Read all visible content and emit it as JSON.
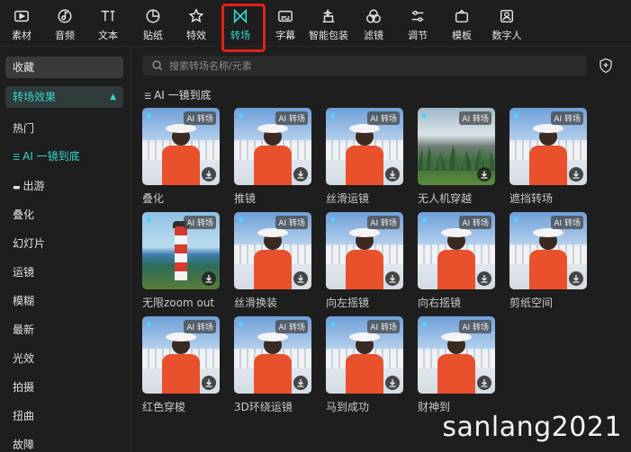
{
  "toolbar": {
    "items": [
      {
        "label": "素材",
        "icon": "media-icon"
      },
      {
        "label": "音频",
        "icon": "audio-icon"
      },
      {
        "label": "文本",
        "icon": "text-icon"
      },
      {
        "label": "贴纸",
        "icon": "sticker-icon"
      },
      {
        "label": "特效",
        "icon": "effects-icon"
      },
      {
        "label": "转场",
        "icon": "transition-icon"
      },
      {
        "label": "字幕",
        "icon": "subtitle-icon"
      },
      {
        "label": "智能包装",
        "icon": "smart-pack-icon"
      },
      {
        "label": "滤镜",
        "icon": "filter-icon"
      },
      {
        "label": "调节",
        "icon": "adjust-icon"
      },
      {
        "label": "模板",
        "icon": "template-icon"
      },
      {
        "label": "数字人",
        "icon": "digital-human-icon"
      }
    ],
    "active_index": 5,
    "accent_color": "#38d6cf",
    "highlight_color": "#e0201b"
  },
  "sidebar": {
    "favorites": "收藏",
    "category": "转场效果",
    "items": [
      {
        "label": "热门"
      },
      {
        "label": "AI 一镜到底",
        "prefix": "☰",
        "selected": true
      },
      {
        "label": "出游",
        "prefix": "▬"
      },
      {
        "label": "叠化"
      },
      {
        "label": "幻灯片"
      },
      {
        "label": "运镜"
      },
      {
        "label": "模糊"
      },
      {
        "label": "最新"
      },
      {
        "label": "光效"
      },
      {
        "label": "拍摄"
      },
      {
        "label": "扭曲"
      },
      {
        "label": "故障"
      }
    ]
  },
  "search": {
    "placeholder": "搜索转场名称/元素"
  },
  "section_title": "AI 一镜到底",
  "cards": [
    {
      "label": "叠化",
      "tag": "AI 转场",
      "style": "person"
    },
    {
      "label": "推镜",
      "tag": "AI 转场",
      "style": "person"
    },
    {
      "label": "丝滑运镜",
      "tag": "AI 转场",
      "style": "person"
    },
    {
      "label": "无人机穿越",
      "tag": "AI 转场",
      "style": "mountain"
    },
    {
      "label": "遮挡转场",
      "tag": "AI 转场",
      "style": "person"
    },
    {
      "label": "无限zoom out",
      "tag": "AI 转场",
      "style": "lighthouse"
    },
    {
      "label": "丝滑换装",
      "tag": "AI 转场",
      "style": "person"
    },
    {
      "label": "向左摇镜",
      "tag": "AI 转场",
      "style": "person"
    },
    {
      "label": "向右摇镜",
      "tag": "AI 转场",
      "style": "person"
    },
    {
      "label": "剪纸空间",
      "tag": "AI 转场",
      "style": "person"
    },
    {
      "label": "红色穿梭",
      "tag": "AI 转场",
      "style": "person"
    },
    {
      "label": "3D环绕运镜",
      "tag": "AI 转场",
      "style": "person"
    },
    {
      "label": "马到成功",
      "tag": "AI 转场",
      "style": "person"
    },
    {
      "label": "财神到",
      "tag": "AI 转场",
      "style": "person"
    }
  ],
  "watermark": "sanlang2021"
}
